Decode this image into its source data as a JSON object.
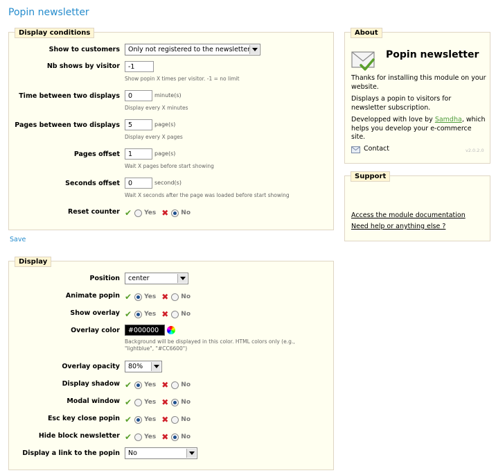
{
  "page": {
    "title": "Popin newsletter"
  },
  "display_conditions": {
    "legend": "Display conditions",
    "show_to_customers": {
      "label": "Show to customers",
      "value": "Only not registered to the newsletter"
    },
    "nb_shows": {
      "label": "Nb shows by visitor",
      "value": "-1",
      "hint": "Show popin X times per visitor. -1 = no limit"
    },
    "time_between": {
      "label": "Time between two displays",
      "value": "0",
      "unit": "minute(s)",
      "hint": "Display every X minutes"
    },
    "pages_between": {
      "label": "Pages between two displays",
      "value": "5",
      "unit": "page(s)",
      "hint": "Display every X pages"
    },
    "pages_offset": {
      "label": "Pages offset",
      "value": "1",
      "unit": "page(s)",
      "hint": "Wait X pages before start showing"
    },
    "seconds_offset": {
      "label": "Seconds offset",
      "value": "0",
      "unit": "second(s)",
      "hint": "Wait X seconds after the page was loaded before start showing"
    },
    "reset_counter": {
      "label": "Reset counter",
      "selected": "No"
    },
    "save_label": "Save"
  },
  "radio_labels": {
    "yes": "Yes",
    "no": "No"
  },
  "display": {
    "legend": "Display",
    "position": {
      "label": "Position",
      "value": "center"
    },
    "animate_popin": {
      "label": "Animate popin",
      "selected": "Yes"
    },
    "show_overlay": {
      "label": "Show overlay",
      "selected": "Yes"
    },
    "overlay_color": {
      "label": "Overlay color",
      "value": "#000000",
      "hint": "Background will be displayed in this color. HTML colors only (e.g., \"lightblue\", \"#CC6600\")"
    },
    "overlay_opacity": {
      "label": "Overlay opacity",
      "value": "80%"
    },
    "display_shadow": {
      "label": "Display shadow",
      "selected": "Yes"
    },
    "modal_window": {
      "label": "Modal window",
      "selected": "No"
    },
    "esc_key_close": {
      "label": "Esc key close popin",
      "selected": "Yes"
    },
    "hide_block_newsletter": {
      "label": "Hide block newsletter",
      "selected": "No"
    },
    "display_link": {
      "label": "Display a link to the popin",
      "value": "No"
    }
  },
  "about": {
    "legend": "About",
    "title": "Popin newsletter",
    "text1": "Thanks for installing this module on your website.",
    "text2": "Displays a popin to visitors for newsletter subscription.",
    "text3_before": "Developped with love by ",
    "text3_link": "Samdha",
    "text3_after": ", which helps you develop your e-commerce site.",
    "contact": "Contact",
    "version": "v2.0.2.0"
  },
  "support": {
    "legend": "Support",
    "doc_link": "Access the module documentation",
    "help_link": "Need help or anything else ?"
  },
  "colors": {
    "accent": "#268ccd",
    "panel_bg": "#fffff0",
    "legend_bg": "#fff6d3",
    "check": "#5aa02c",
    "cross": "#d0202a"
  }
}
